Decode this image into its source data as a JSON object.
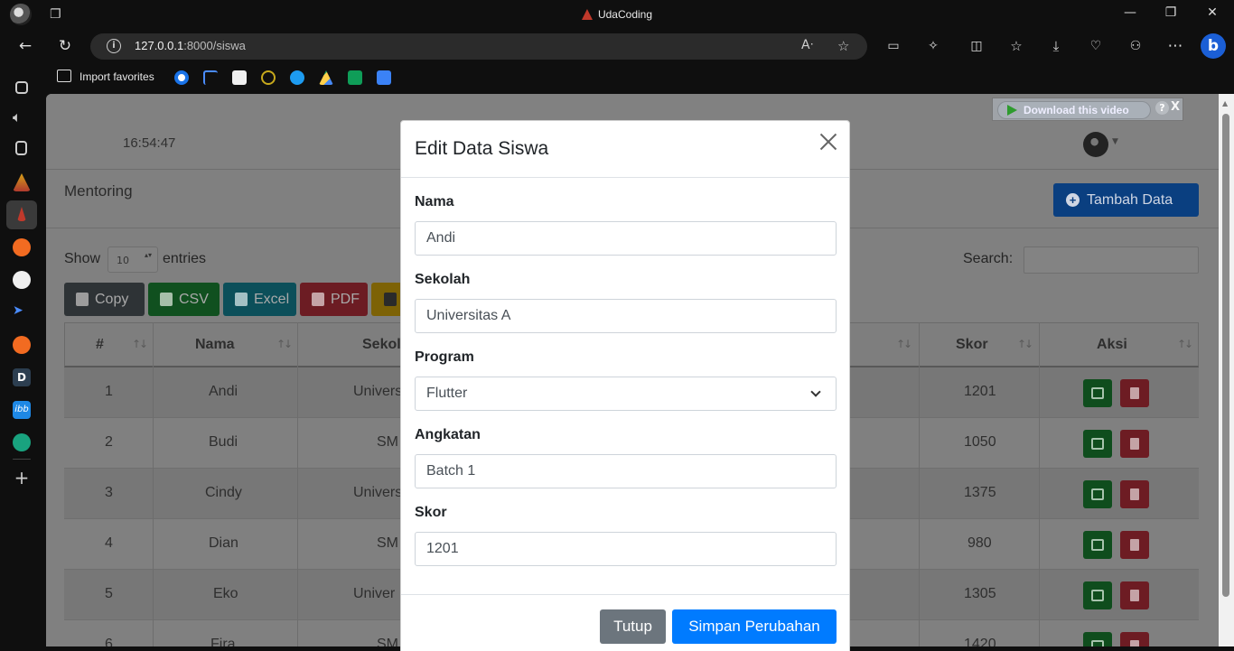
{
  "browser": {
    "window_title": "UdaCoding",
    "url_host": "127.0.0.1",
    "url_rest": ":8000/siswa",
    "import_favorites": "Import favorites"
  },
  "page": {
    "clock": "16:54:47",
    "download_video": "Download this video",
    "help": "?",
    "close_x": "X",
    "section_title": "Mentoring",
    "tambah_label": "Tambah Data",
    "show_label": "Show",
    "entries_value": "10",
    "entries_label": "entries",
    "search_label": "Search:",
    "buttons": {
      "copy": "Copy",
      "csv": "CSV",
      "excel": "Excel",
      "pdf": "PDF"
    },
    "table": {
      "headers": [
        "#",
        "Nama",
        "Sekol",
        "Skor",
        "Aksi"
      ],
      "rows": [
        {
          "no": "1",
          "nama": "Andi",
          "sekolah": "Univers",
          "skor": "1201"
        },
        {
          "no": "2",
          "nama": "Budi",
          "sekolah": "SM",
          "skor": "1050"
        },
        {
          "no": "3",
          "nama": "Cindy",
          "sekolah": "Univers",
          "skor": "1375"
        },
        {
          "no": "4",
          "nama": "Dian",
          "sekolah": "SM",
          "skor": "980"
        },
        {
          "no": "5",
          "nama": "Eko",
          "sekolah": "Univer",
          "skor": "1305"
        },
        {
          "no": "6",
          "nama": "Fira",
          "sekolah": "SM",
          "skor": "1420"
        }
      ]
    }
  },
  "modal": {
    "title": "Edit Data Siswa",
    "fields": {
      "nama_label": "Nama",
      "nama_value": "Andi",
      "sekolah_label": "Sekolah",
      "sekolah_value": "Universitas A",
      "program_label": "Program",
      "program_value": "Flutter",
      "angkatan_label": "Angkatan",
      "angkatan_value": "Batch 1",
      "skor_label": "Skor",
      "skor_value": "1201"
    },
    "close_label": "Tutup",
    "save_label": "Simpan Perubahan"
  },
  "colors": {
    "primary": "#007bff",
    "secondary": "#6c757d",
    "overlay": "#808080"
  }
}
